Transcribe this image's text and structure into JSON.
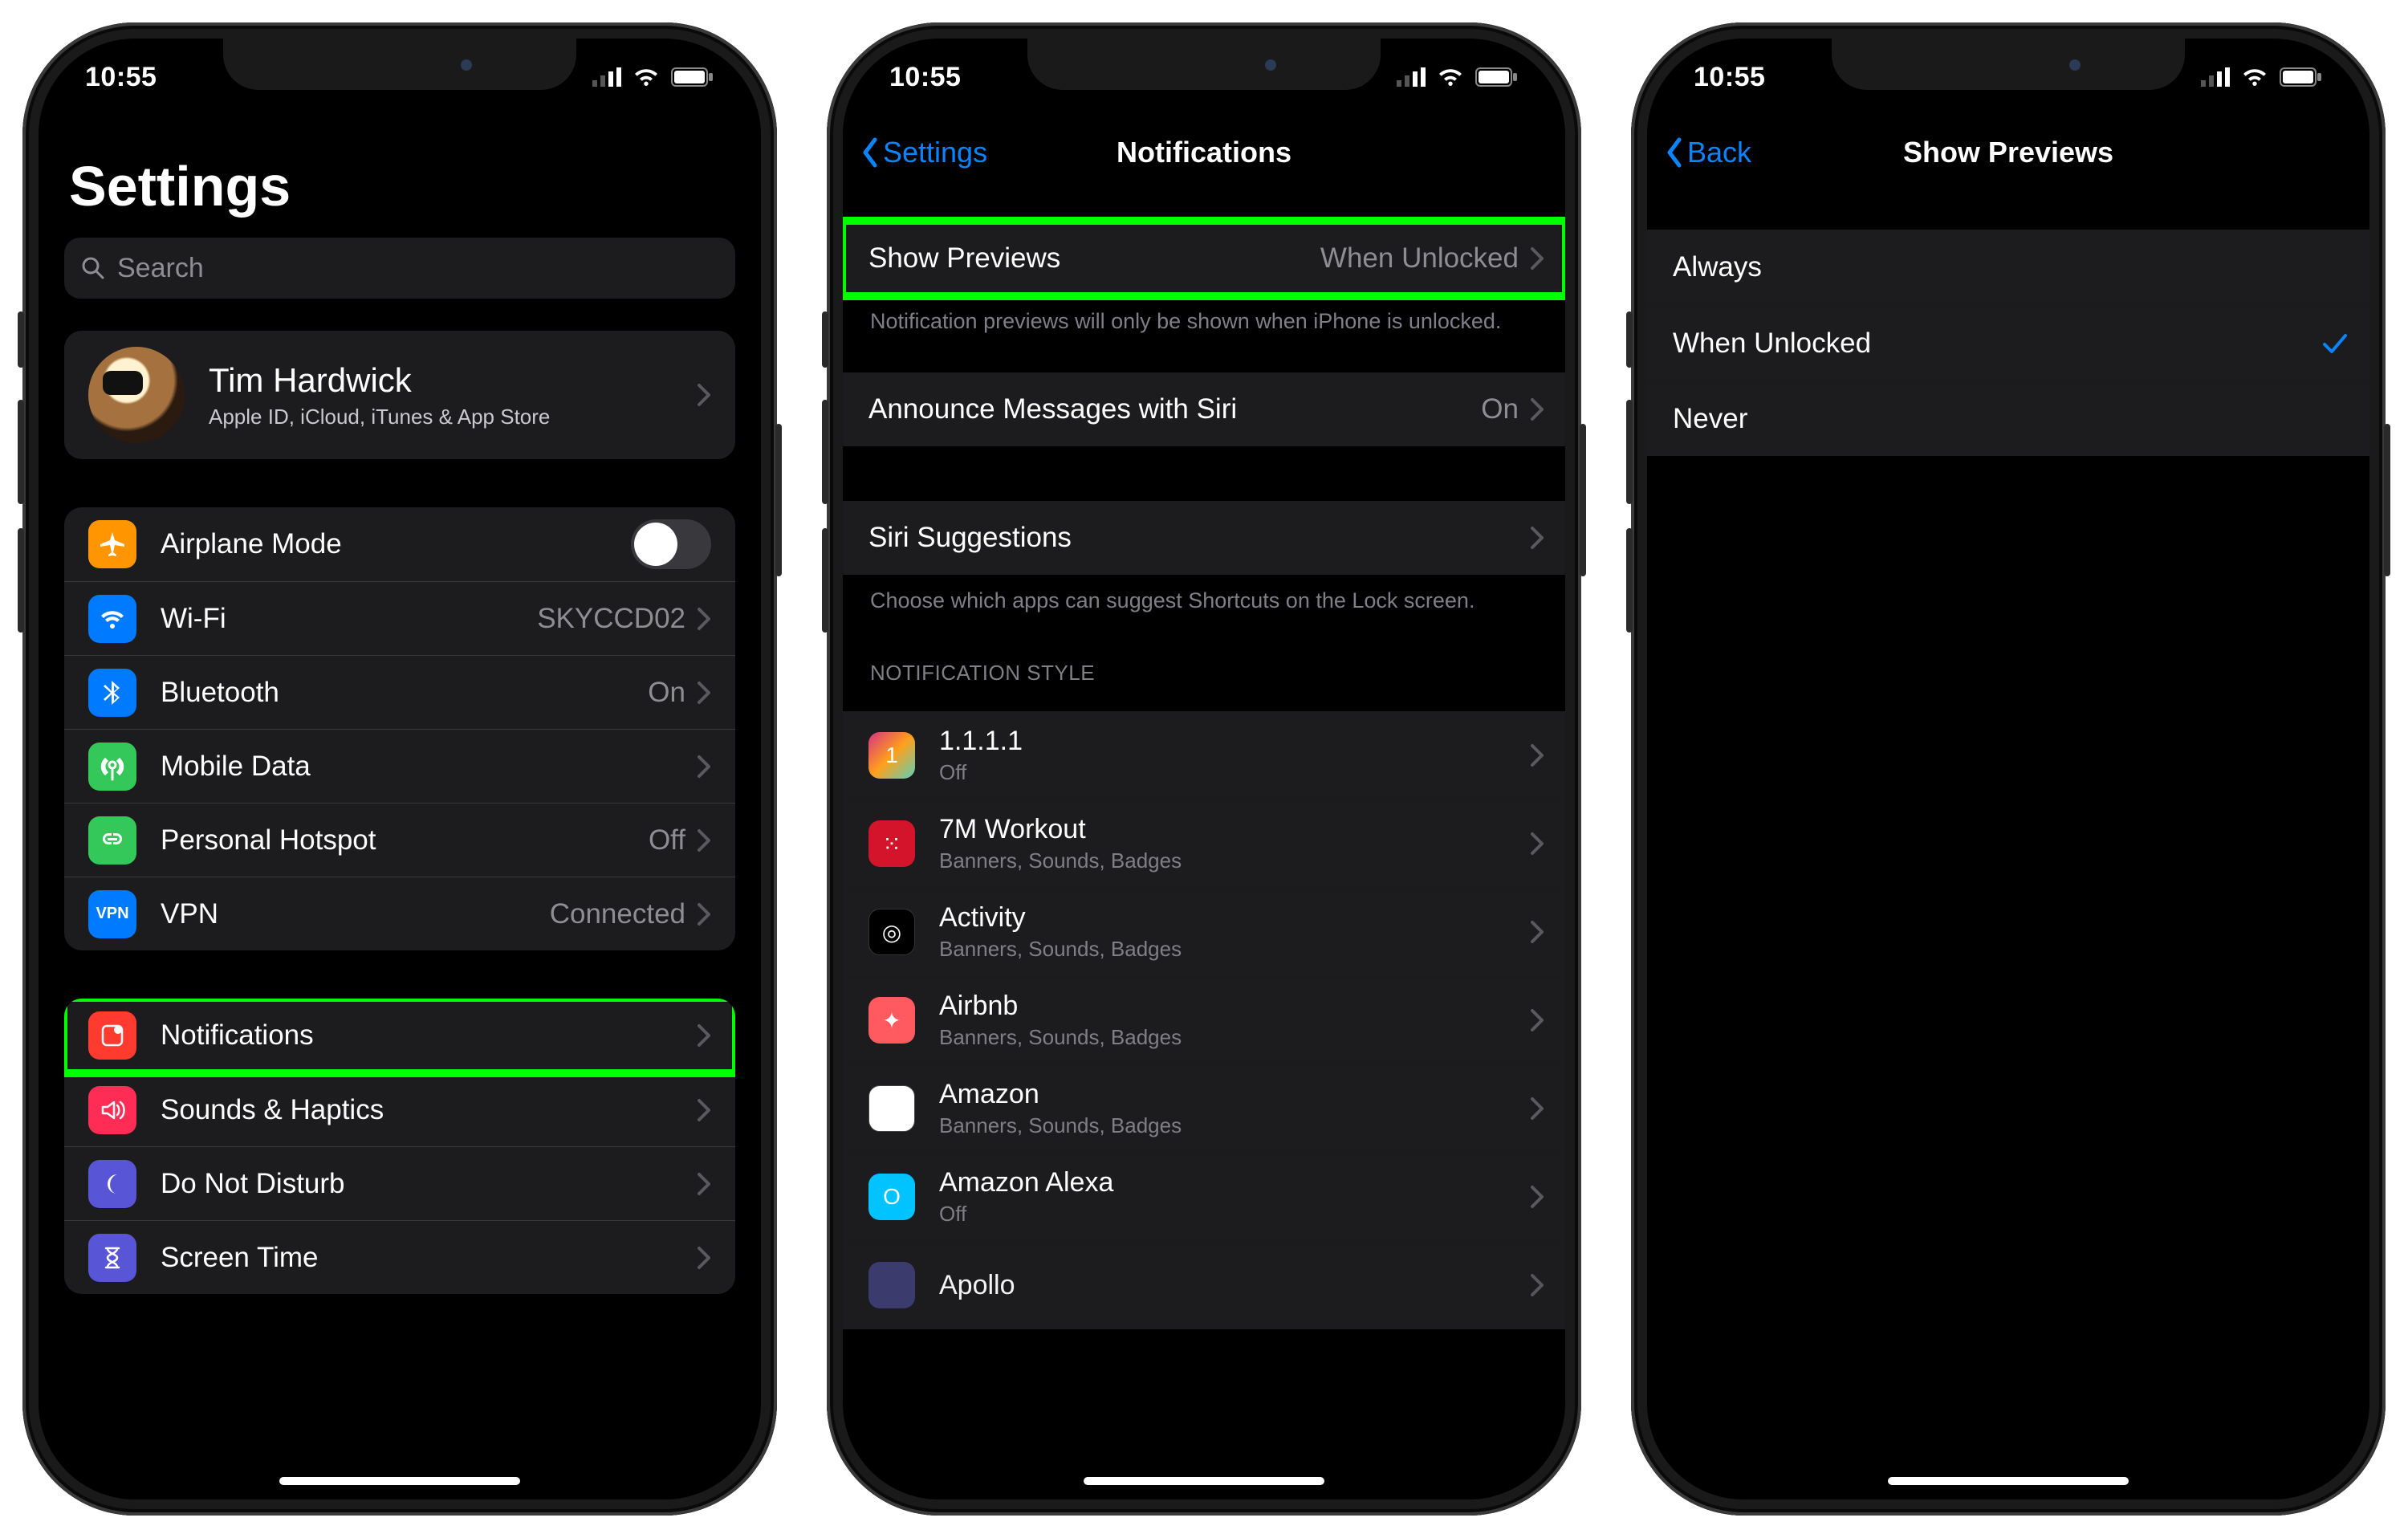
{
  "status": {
    "time": "10:55"
  },
  "panel1": {
    "title": "Settings",
    "search_placeholder": "Search",
    "profile": {
      "name": "Tim Hardwick",
      "desc": "Apple ID, iCloud, iTunes & App Store"
    },
    "group2": {
      "airplane": "Airplane Mode",
      "wifi": "Wi-Fi",
      "wifi_val": "SKYCCD02",
      "bt": "Bluetooth",
      "bt_val": "On",
      "mobile": "Mobile Data",
      "hotspot": "Personal Hotspot",
      "hotspot_val": "Off",
      "vpn": "VPN",
      "vpn_val": "Connected"
    },
    "group3": {
      "notifications": "Notifications",
      "sounds": "Sounds & Haptics",
      "dnd": "Do Not Disturb",
      "screentime": "Screen Time"
    }
  },
  "panel2": {
    "back": "Settings",
    "title": "Notifications",
    "previews": "Show Previews",
    "previews_val": "When Unlocked",
    "previews_note": "Notification previews will only be shown when iPhone is unlocked.",
    "announce": "Announce Messages with Siri",
    "announce_val": "On",
    "siri": "Siri Suggestions",
    "siri_note": "Choose which apps can suggest Shortcuts on the Lock screen.",
    "style_header": "NOTIFICATION STYLE",
    "apps": [
      {
        "name": "1.1.1.1",
        "sub": "Off",
        "bg": "linear-gradient(135deg,#d63384,#ff9f1a,#5dd1b9)",
        "glyph": "1"
      },
      {
        "name": "7M Workout",
        "sub": "Banners, Sounds, Badges",
        "bg": "#d3142b",
        "glyph": "⁙"
      },
      {
        "name": "Activity",
        "sub": "Banners, Sounds, Badges",
        "bg": "#000",
        "glyph": "◎"
      },
      {
        "name": "Airbnb",
        "sub": "Banners, Sounds, Badges",
        "bg": "#ff5a5f",
        "glyph": "✦"
      },
      {
        "name": "Amazon",
        "sub": "Banners, Sounds, Badges",
        "bg": "#fff",
        "glyph": ""
      },
      {
        "name": "Amazon Alexa",
        "sub": "Off",
        "bg": "#00c3ff",
        "glyph": "O"
      },
      {
        "name": "Apollo",
        "sub": "",
        "bg": "#3b3b6d",
        "glyph": ""
      }
    ]
  },
  "panel3": {
    "back": "Back",
    "title": "Show Previews",
    "options": [
      {
        "label": "Always",
        "selected": false
      },
      {
        "label": "When Unlocked",
        "selected": true
      },
      {
        "label": "Never",
        "selected": false
      }
    ]
  }
}
